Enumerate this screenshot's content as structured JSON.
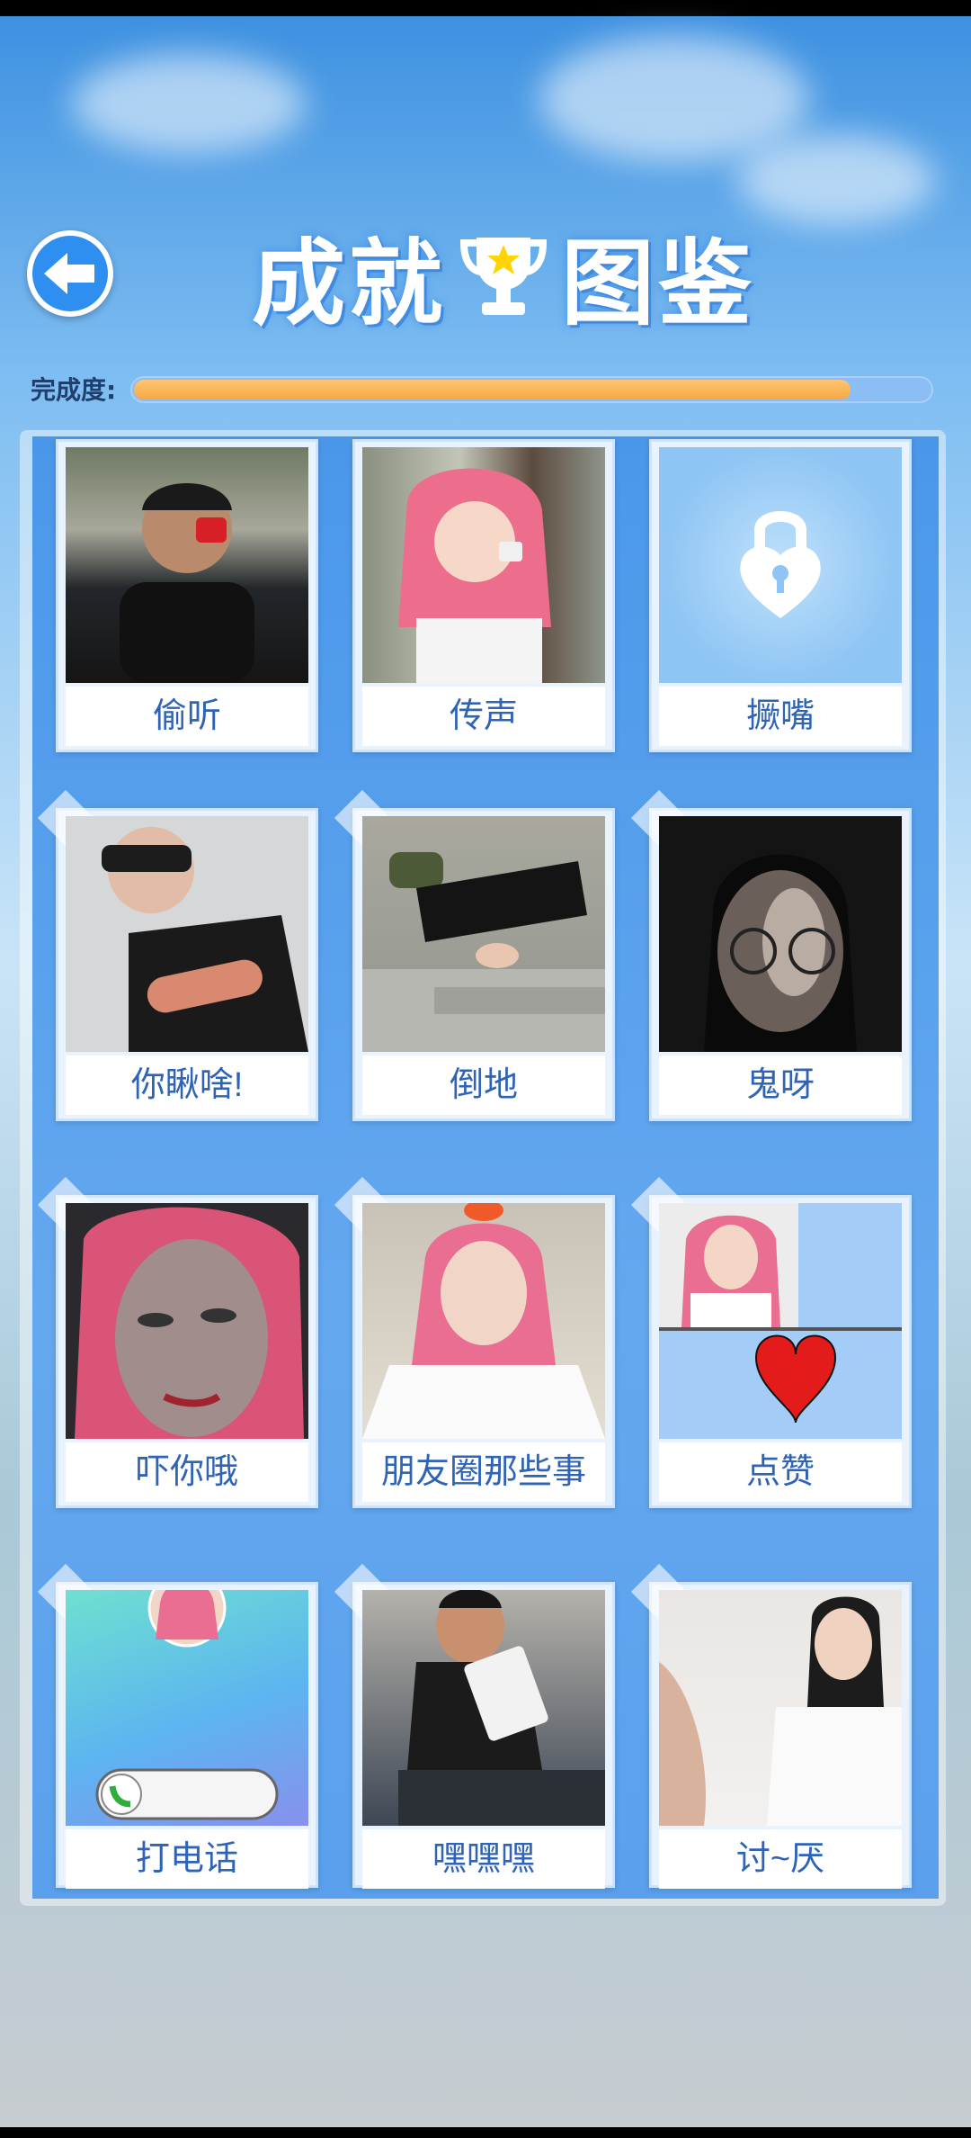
{
  "header": {
    "title_left": "成就",
    "title_right": "图鉴",
    "back_icon": "back-arrow-icon",
    "trophy_icon": "trophy-star-icon"
  },
  "progress": {
    "label": "完成度:",
    "fraction": 0.9
  },
  "colors": {
    "accent": "#2f8ff0",
    "progress_fill": "#f6a743",
    "label_text": "#2f63b5"
  },
  "achievements": [
    {
      "label": "偷听",
      "locked": false
    },
    {
      "label": "传声",
      "locked": false
    },
    {
      "label": "撅嘴",
      "locked": true
    },
    {
      "label": "你瞅啥!",
      "locked": false
    },
    {
      "label": "倒地",
      "locked": false
    },
    {
      "label": "鬼呀",
      "locked": false
    },
    {
      "label": "吓你哦",
      "locked": false
    },
    {
      "label": "朋友圈那些事",
      "locked": false
    },
    {
      "label": "点赞",
      "locked": false
    },
    {
      "label": "打电话",
      "locked": false
    },
    {
      "label": "嘿嘿嘿",
      "locked": false
    },
    {
      "label": "讨~厌",
      "locked": false
    }
  ]
}
